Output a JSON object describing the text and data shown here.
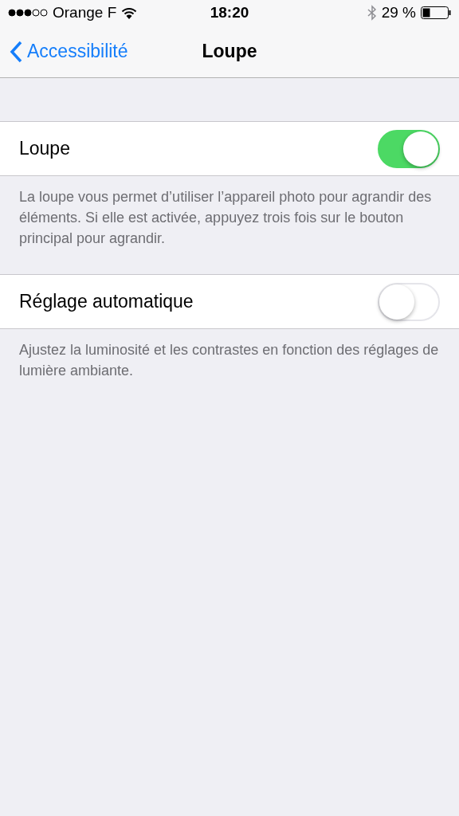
{
  "status_bar": {
    "carrier": "Orange F",
    "time": "18:20",
    "battery": "29 %"
  },
  "nav_bar": {
    "back": "Accessibilité",
    "title": "Loupe"
  },
  "sections": [
    {
      "label": "Loupe",
      "on": true,
      "footer": "La loupe vous permet d’utiliser l’appareil photo pour agrandir des éléments. Si elle est activée, appuyez trois fois sur le bouton principal pour agrandir."
    },
    {
      "label": "Réglage automatique",
      "on": false,
      "footer": "Ajustez la luminosité et les contrastes en fonction des réglages de lumière ambiante."
    }
  ]
}
